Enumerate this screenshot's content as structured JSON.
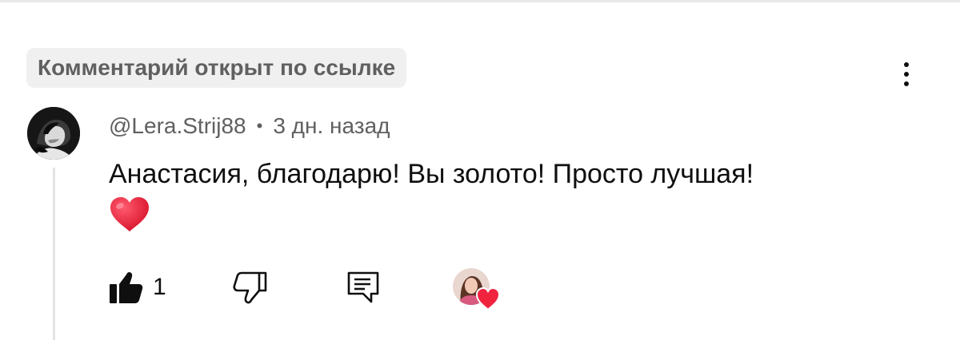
{
  "badge": {
    "label": "Комментарий открыт по ссылке"
  },
  "comment": {
    "author": "@Lera.Strij88",
    "separator": "•",
    "time": "3 дн. назад",
    "text": "Анастасия, благодарю! Вы золото! Просто лучшая!",
    "emoji": "red-heart-emoji",
    "likes": "1"
  },
  "icons": {
    "menu": "more-vert-icon",
    "like": "thumb-up-filled-icon",
    "dislike": "thumb-down-outline-icon",
    "reply": "comment-reply-icon",
    "creator_heart": "creator-heart-icon"
  },
  "colors": {
    "text_primary": "#0f0f0f",
    "text_secondary": "#606060",
    "badge_background": "#f0f0f0",
    "heart": "#f0233f"
  }
}
